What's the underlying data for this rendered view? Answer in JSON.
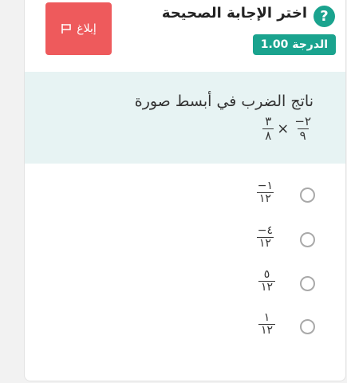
{
  "header": {
    "instruction": "اختر الإجابة الصحيحة",
    "grade_label": "الدرجة 1.00",
    "report_label": "إبلاغ",
    "help_symbol": "?"
  },
  "question": {
    "text": "ناتج الضرب في أبسط صورة",
    "operator": "×",
    "operand1": {
      "numerator": "−٢",
      "denominator": "٩"
    },
    "operand2": {
      "numerator": "٣",
      "denominator": "٨"
    }
  },
  "options": [
    {
      "numerator": "−١",
      "denominator": "١٢"
    },
    {
      "numerator": "−٤",
      "denominator": "١٢"
    },
    {
      "numerator": "٥",
      "denominator": "١٢"
    },
    {
      "numerator": "١",
      "denominator": "١٢"
    }
  ],
  "colors": {
    "accent": "#1aa38e",
    "report": "#ee5a5c",
    "panel": "#e7f3f3"
  }
}
